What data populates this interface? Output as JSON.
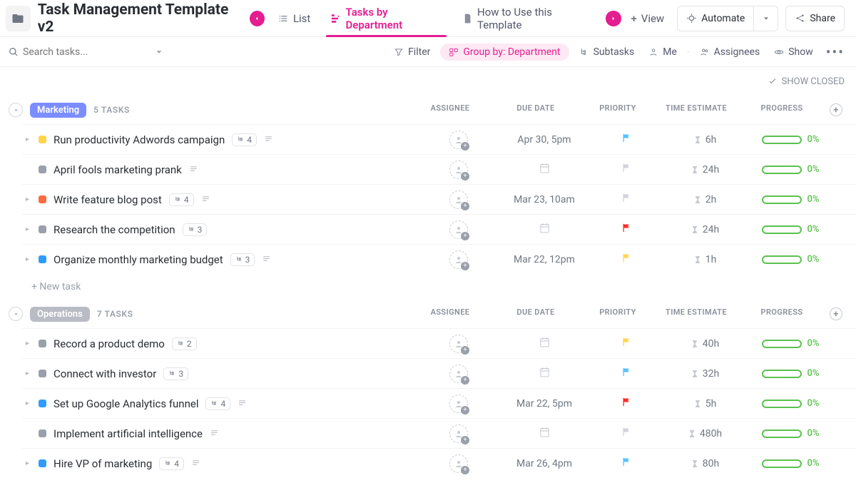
{
  "header": {
    "title": "Task Management Template v2",
    "views": {
      "list": "List",
      "byDept": "Tasks by Department",
      "howTo": "How to Use this Template",
      "addView": "View"
    },
    "automate": "Automate",
    "share": "Share"
  },
  "toolbar": {
    "searchPlaceholder": "Search tasks...",
    "filter": "Filter",
    "groupBy": "Group by: Department",
    "subtasks": "Subtasks",
    "me": "Me",
    "assignees": "Assignees",
    "show": "Show"
  },
  "subbar": {
    "showClosed": "SHOW CLOSED"
  },
  "columns": {
    "assignee": "ASSIGNEE",
    "due": "DUE DATE",
    "priority": "PRIORITY",
    "estimate": "TIME ESTIMATE",
    "progress": "PROGRESS"
  },
  "newTask": "+ New task",
  "groups": [
    {
      "name": "Marketing",
      "badgeClass": "marketing",
      "count": "5 TASKS",
      "tasks": [
        {
          "caret": true,
          "status": "#ffd54a",
          "name": "Run productivity Adwords campaign",
          "sub": "4",
          "desc": true,
          "due": "Apr 30, 5pm",
          "flag": "#55c3ff",
          "est": "6h",
          "prog": "0%"
        },
        {
          "caret": false,
          "status": "#9aa0aa",
          "name": "April fools marketing prank",
          "sub": "",
          "desc": true,
          "due": "",
          "flag": "#d0d3da",
          "est": "24h",
          "prog": "0%"
        },
        {
          "caret": true,
          "status": "#ff6a3d",
          "name": "Write feature blog post",
          "sub": "4",
          "desc": true,
          "due": "Mar 23, 10am",
          "flag": "#d0d3da",
          "est": "2h",
          "prog": "0%"
        },
        {
          "caret": true,
          "status": "#9aa0aa",
          "name": "Research the competition",
          "sub": "3",
          "desc": false,
          "due": "",
          "flag": "#ff2b2b",
          "est": "24h",
          "prog": "0%"
        },
        {
          "caret": true,
          "status": "#2f9bff",
          "name": "Organize monthly marketing budget",
          "sub": "3",
          "desc": true,
          "due": "Mar 22, 12pm",
          "flag": "#ffd54a",
          "est": "1h",
          "prog": "0%"
        }
      ]
    },
    {
      "name": "Operations",
      "badgeClass": "operations",
      "count": "7 TASKS",
      "tasks": [
        {
          "caret": true,
          "status": "#9aa0aa",
          "name": "Record a product demo",
          "sub": "2",
          "desc": false,
          "due": "",
          "flag": "#ffd54a",
          "est": "40h",
          "prog": "0%"
        },
        {
          "caret": true,
          "status": "#9aa0aa",
          "name": "Connect with investor",
          "sub": "3",
          "desc": false,
          "due": "",
          "flag": "#55c3ff",
          "est": "32h",
          "prog": "0%"
        },
        {
          "caret": true,
          "status": "#2f9bff",
          "name": "Set up Google Analytics funnel",
          "sub": "4",
          "desc": true,
          "due": "Mar 22, 5pm",
          "flag": "#ff2b2b",
          "est": "5h",
          "prog": "0%"
        },
        {
          "caret": false,
          "status": "#9aa0aa",
          "name": "Implement artificial intelligence",
          "sub": "",
          "desc": true,
          "due": "",
          "flag": "#d0d3da",
          "est": "480h",
          "prog": "0%"
        },
        {
          "caret": true,
          "status": "#2f9bff",
          "name": "Hire VP of marketing",
          "sub": "4",
          "desc": true,
          "due": "Mar 26, 4pm",
          "flag": "#55c3ff",
          "est": "80h",
          "prog": "0%"
        }
      ]
    }
  ]
}
